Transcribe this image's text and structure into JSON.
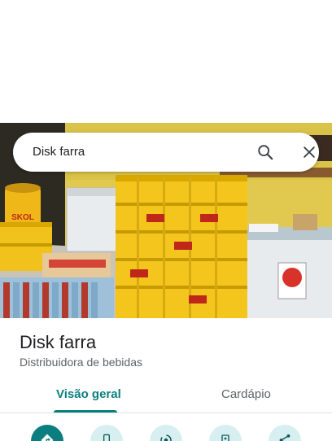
{
  "search": {
    "query": "Disk farra"
  },
  "place": {
    "name": "Disk farra",
    "category": "Distribuidora de bebidas"
  },
  "tabs": [
    {
      "label": "Visão geral",
      "active": true
    },
    {
      "label": "Cardápio",
      "active": false
    }
  ],
  "photo_sign": "SKOL",
  "actions": [
    {
      "icon": "directions-icon",
      "primary": true
    },
    {
      "icon": "phone-icon",
      "primary": false
    },
    {
      "icon": "share-location-icon",
      "primary": false
    },
    {
      "icon": "save-icon",
      "primary": false
    },
    {
      "icon": "share-icon",
      "primary": false
    }
  ],
  "colors": {
    "accent": "#0b7f7f",
    "action_bg": "#d7eff0",
    "text": "#202124",
    "subtext": "#5f6368"
  }
}
